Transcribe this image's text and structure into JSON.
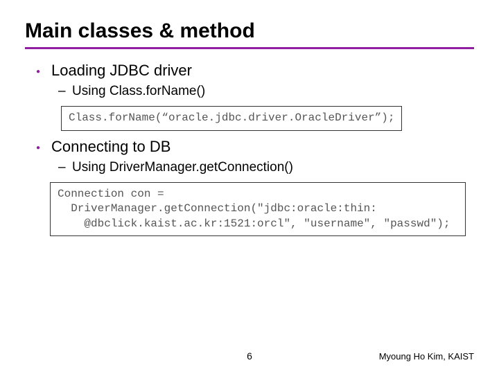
{
  "title": "Main classes & method",
  "bullets": {
    "b1": {
      "text": "Loading JDBC driver",
      "sub1": "Using Class.forName()",
      "code": "Class.forName(“oracle.jdbc.driver.OracleDriver”);"
    },
    "b2": {
      "text": "Connecting to DB",
      "sub1": "Using DriverManager.getConnection()",
      "code": "Connection con =\n  DriverManager.getConnection(\"jdbc:oracle:thin:\n    @dbclick.kaist.ac.kr:1521:orcl\", \"username\", \"passwd\");"
    }
  },
  "footer": {
    "page": "6",
    "author": "Myoung Ho Kim, KAIST"
  }
}
